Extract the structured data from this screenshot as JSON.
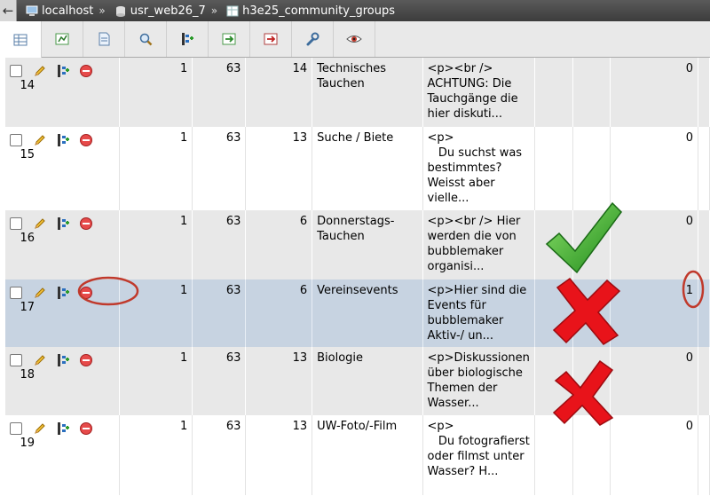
{
  "breadcrumb": {
    "server": "localhost",
    "database": "usr_web26_7",
    "table": "h3e25_community_groups",
    "separator": "»"
  },
  "toolbar": {
    "tabs": [
      {
        "icon": "browse-icon",
        "active": true
      },
      {
        "icon": "structure-icon"
      },
      {
        "icon": "sql-icon"
      },
      {
        "icon": "search-icon"
      },
      {
        "icon": "insert-icon"
      },
      {
        "icon": "export-icon"
      },
      {
        "icon": "import-icon"
      },
      {
        "icon": "operations-icon"
      },
      {
        "icon": "tracking-icon"
      }
    ]
  },
  "rows": [
    {
      "id": "14",
      "c1": "1",
      "c2": "63",
      "c3": "14",
      "name": "Technisches Tauchen",
      "desc": "<p><br />\nACHTUNG: Die Tauchgänge die hier diskuti...",
      "c4": "0",
      "style": "odd"
    },
    {
      "id": "15",
      "c1": "1",
      "c2": "63",
      "c3": "13",
      "name": "Suche / Biete",
      "desc": "<p>\n   Du suchst was bestimmtes? Weisst aber vielle...",
      "c4": "0",
      "style": "even"
    },
    {
      "id": "16",
      "c1": "1",
      "c2": "63",
      "c3": "6",
      "name": "Donnerstags-Tauchen",
      "desc": "<p><br /> Hier werden die von bubblemaker organisi...",
      "c4": "0",
      "style": "odd"
    },
    {
      "id": "17",
      "c1": "1",
      "c2": "63",
      "c3": "6",
      "name": "Vereinsevents",
      "desc": "<p>Hier sind die Events für bubblemaker Aktiv-/ un...",
      "c4": "1",
      "style": "hl"
    },
    {
      "id": "18",
      "c1": "1",
      "c2": "63",
      "c3": "13",
      "name": "Biologie",
      "desc": "<p>Diskussionen über biologische Themen der Wasser...",
      "c4": "0",
      "style": "odd"
    },
    {
      "id": "19",
      "c1": "1",
      "c2": "63",
      "c3": "13",
      "name": "UW-Foto/-Film",
      "desc": "<p>\n   Du fotografierst oder filmst unter Wasser? H...",
      "c4": "0",
      "style": "even"
    }
  ],
  "colors": {
    "row_odd": "#e8e8e8",
    "row_even": "#ffffff",
    "row_highlight": "#c7d3e1",
    "annotation_red": "#c0392b",
    "check_green": "#3aa528",
    "cross_red": "#e8131a"
  }
}
